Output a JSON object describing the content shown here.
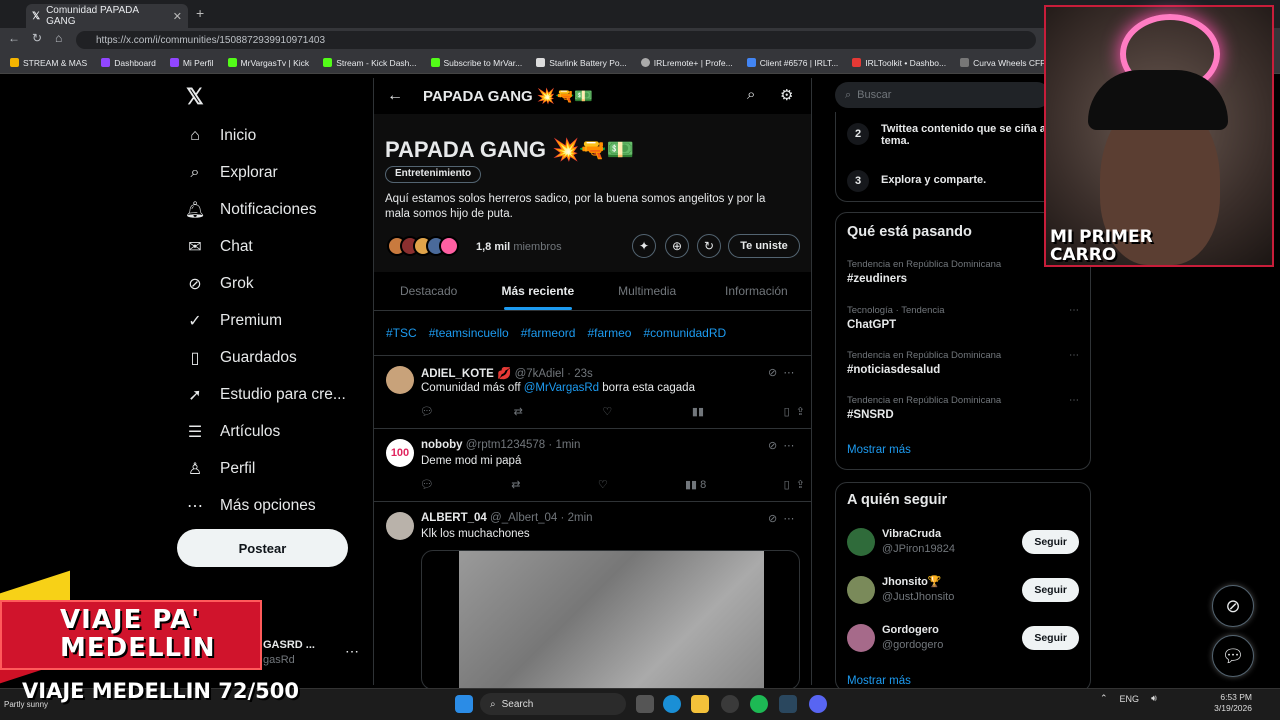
{
  "browser": {
    "tab_title": "Comunidad PAPADA GANG",
    "url": "https://x.com/i/communities/1508872939910971403",
    "bookmarks": [
      "STREAM & MAS",
      "Dashboard",
      "Mi Perfil",
      "MrVargasTv | Kick",
      "Stream - Kick Dash...",
      "Subscribe to MrVar...",
      "Starlink Battery Po...",
      "IRLremote+ | Profe...",
      "Client #6576 | IRLT...",
      "IRLToolkit • Dashbo...",
      "Curva Wheels CFF76"
    ]
  },
  "nav": {
    "items": [
      "Inicio",
      "Explorar",
      "Notificaciones",
      "Chat",
      "Grok",
      "Premium",
      "Guardados",
      "Estudio para cre...",
      "Artículos",
      "Perfil",
      "Más opciones"
    ],
    "post_button": "Postear",
    "account_name": "GASRD ...",
    "account_handle": "gasRd"
  },
  "community": {
    "header_title": "PAPADA GANG 💥🔫💵",
    "name": "PAPADA GANG 💥🔫💵",
    "category": "Entretenimiento",
    "description": "Aquí estamos solos herreros sadico, por la buena somos angelitos y por la mala somos hijo de puta.",
    "members_count": "1,8 mil",
    "members_label": "miembros",
    "joined_button": "Te uniste",
    "tabs": [
      "Destacado",
      "Más reciente",
      "Multimedia",
      "Información"
    ],
    "hashtags": [
      "#TSC",
      "#teamsincuello",
      "#farmeord",
      "#farmeo",
      "#comunidadRD"
    ]
  },
  "posts": [
    {
      "name": "ADIEL_KOTE 💋",
      "handle": "@7kAdiel",
      "time": "23s",
      "text_pre": "Comunidad más off ",
      "mention": "@MrVargasRd",
      "text_post": " borra esta cagada",
      "views": ""
    },
    {
      "name": "noboby",
      "handle": "@rptm1234578",
      "time": "1min",
      "text_pre": "Deme mod mi papá",
      "mention": "",
      "text_post": "",
      "views": "8"
    },
    {
      "name": "ALBERT_04",
      "handle": "@_Albert_04",
      "time": "2min",
      "text_pre": "Klk los muchachones",
      "mention": "",
      "text_post": "",
      "views": ""
    }
  ],
  "right": {
    "search_placeholder": "Buscar",
    "steps": [
      {
        "n": "2",
        "text": "Twittea contenido que se ciña a tema."
      },
      {
        "n": "3",
        "text": "Explora y comparte."
      }
    ],
    "trending_title": "Qué está pasando",
    "trends": [
      {
        "context": "Tendencia en República Dominicana",
        "topic": "#zeudiners"
      },
      {
        "context": "Tecnología · Tendencia",
        "topic": "ChatGPT"
      },
      {
        "context": "Tendencia en República Dominicana",
        "topic": "#noticiasdesalud"
      },
      {
        "context": "Tendencia en República Dominicana",
        "topic": "#SNSRD"
      }
    ],
    "show_more": "Mostrar más",
    "follow_title": "A quién seguir",
    "follow": [
      {
        "name": "VibraCruda",
        "handle": "@JPiron19824",
        "btn": "Seguir"
      },
      {
        "name": "Jhonsito🏆",
        "handle": "@JustJhonsito",
        "btn": "Seguir"
      },
      {
        "name": "Gordogero",
        "handle": "@gordogero",
        "btn": "Seguir"
      }
    ],
    "show_more_2": "Mostrar más"
  },
  "overlay": {
    "cam_text": "MI PRIMER CARRO",
    "viaje_text": "VIAJE PA' MEDELLIN",
    "counter": "VIAJE MEDELLIN 72/500"
  },
  "taskbar": {
    "weather": "Partly sunny",
    "search": "Search",
    "lang": "ENG",
    "time": "6:53 PM",
    "date": "3/19/2026"
  }
}
